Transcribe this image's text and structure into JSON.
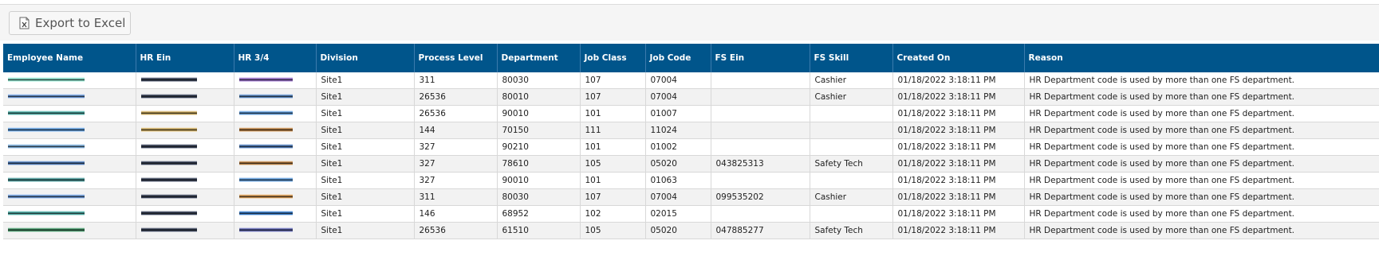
{
  "toolbar": {
    "export_label": "Export to Excel",
    "export_icon": "excel-icon"
  },
  "table": {
    "columns": [
      "Employee Name",
      "HR Ein",
      "HR 3/4",
      "Division",
      "Process Level",
      "Department",
      "Job Class",
      "Job Code",
      "FS Ein",
      "FS Skill",
      "Created On",
      "Reason"
    ],
    "rows": [
      {
        "division": "Site1",
        "process_level": "311",
        "department": "80030",
        "job_class": "107",
        "job_code": "07004",
        "fs_ein": "",
        "fs_skill": "Cashier",
        "created_on": "01/18/2022 3:18:11 PM",
        "reason": "HR Department code is used by more than one FS department."
      },
      {
        "division": "Site1",
        "process_level": "26536",
        "department": "80010",
        "job_class": "107",
        "job_code": "07004",
        "fs_ein": "",
        "fs_skill": "Cashier",
        "created_on": "01/18/2022 3:18:11 PM",
        "reason": "HR Department code is used by more than one FS department."
      },
      {
        "division": "Site1",
        "process_level": "26536",
        "department": "90010",
        "job_class": "101",
        "job_code": "01007",
        "fs_ein": "",
        "fs_skill": "",
        "created_on": "01/18/2022 3:18:11 PM",
        "reason": "HR Department code is used by more than one FS department."
      },
      {
        "division": "Site1",
        "process_level": "144",
        "department": "70150",
        "job_class": "111",
        "job_code": "11024",
        "fs_ein": "",
        "fs_skill": "",
        "created_on": "01/18/2022 3:18:11 PM",
        "reason": "HR Department code is used by more than one FS department."
      },
      {
        "division": "Site1",
        "process_level": "327",
        "department": "90210",
        "job_class": "101",
        "job_code": "01002",
        "fs_ein": "",
        "fs_skill": "",
        "created_on": "01/18/2022 3:18:11 PM",
        "reason": "HR Department code is used by more than one FS department."
      },
      {
        "division": "Site1",
        "process_level": "327",
        "department": "78610",
        "job_class": "105",
        "job_code": "05020",
        "fs_ein": "043825313",
        "fs_skill": "Safety Tech",
        "created_on": "01/18/2022 3:18:11 PM",
        "reason": "HR Department code is used by more than one FS department."
      },
      {
        "division": "Site1",
        "process_level": "327",
        "department": "90010",
        "job_class": "101",
        "job_code": "01063",
        "fs_ein": "",
        "fs_skill": "",
        "created_on": "01/18/2022 3:18:11 PM",
        "reason": "HR Department code is used by more than one FS department."
      },
      {
        "division": "Site1",
        "process_level": "311",
        "department": "80030",
        "job_class": "107",
        "job_code": "07004",
        "fs_ein": "099535202",
        "fs_skill": "Cashier",
        "created_on": "01/18/2022 3:18:11 PM",
        "reason": "HR Department code is used by more than one FS department."
      },
      {
        "division": "Site1",
        "process_level": "146",
        "department": "68952",
        "job_class": "102",
        "job_code": "02015",
        "fs_ein": "",
        "fs_skill": "",
        "created_on": "01/18/2022 3:18:11 PM",
        "reason": "HR Department code is used by more than one FS department."
      },
      {
        "division": "Site1",
        "process_level": "26536",
        "department": "61510",
        "job_class": "105",
        "job_code": "05020",
        "fs_ein": "047885277",
        "fs_skill": "Safety Tech",
        "created_on": "01/18/2022 3:18:11 PM",
        "reason": "HR Department code is used by more than one FS department."
      }
    ],
    "redaction_colors": {
      "name": [
        "#7ee0c8",
        "#5b8fd6",
        "#3aa7a0",
        "#4a90d9",
        "#6fa8dc",
        "#3b6fb6",
        "#2e8b8b",
        "#5b8fd6",
        "#3aa7a0",
        "#2e8b57"
      ],
      "hr_ein": [
        "#1f2a44",
        "#1f2a44",
        "#c8a24a",
        "#c8a24a",
        "#1f2a44",
        "#1f2a44",
        "#1f2a44",
        "#1f2a44",
        "#1f2a44",
        "#1f2a44"
      ],
      "hr34": [
        "#8a5bc4",
        "#4a7fc1",
        "#4a90d9",
        "#b7742d",
        "#3b6fb6",
        "#b7742d",
        "#4a90d9",
        "#d08a3a",
        "#1e6fc9",
        "#4b52a8"
      ]
    }
  }
}
